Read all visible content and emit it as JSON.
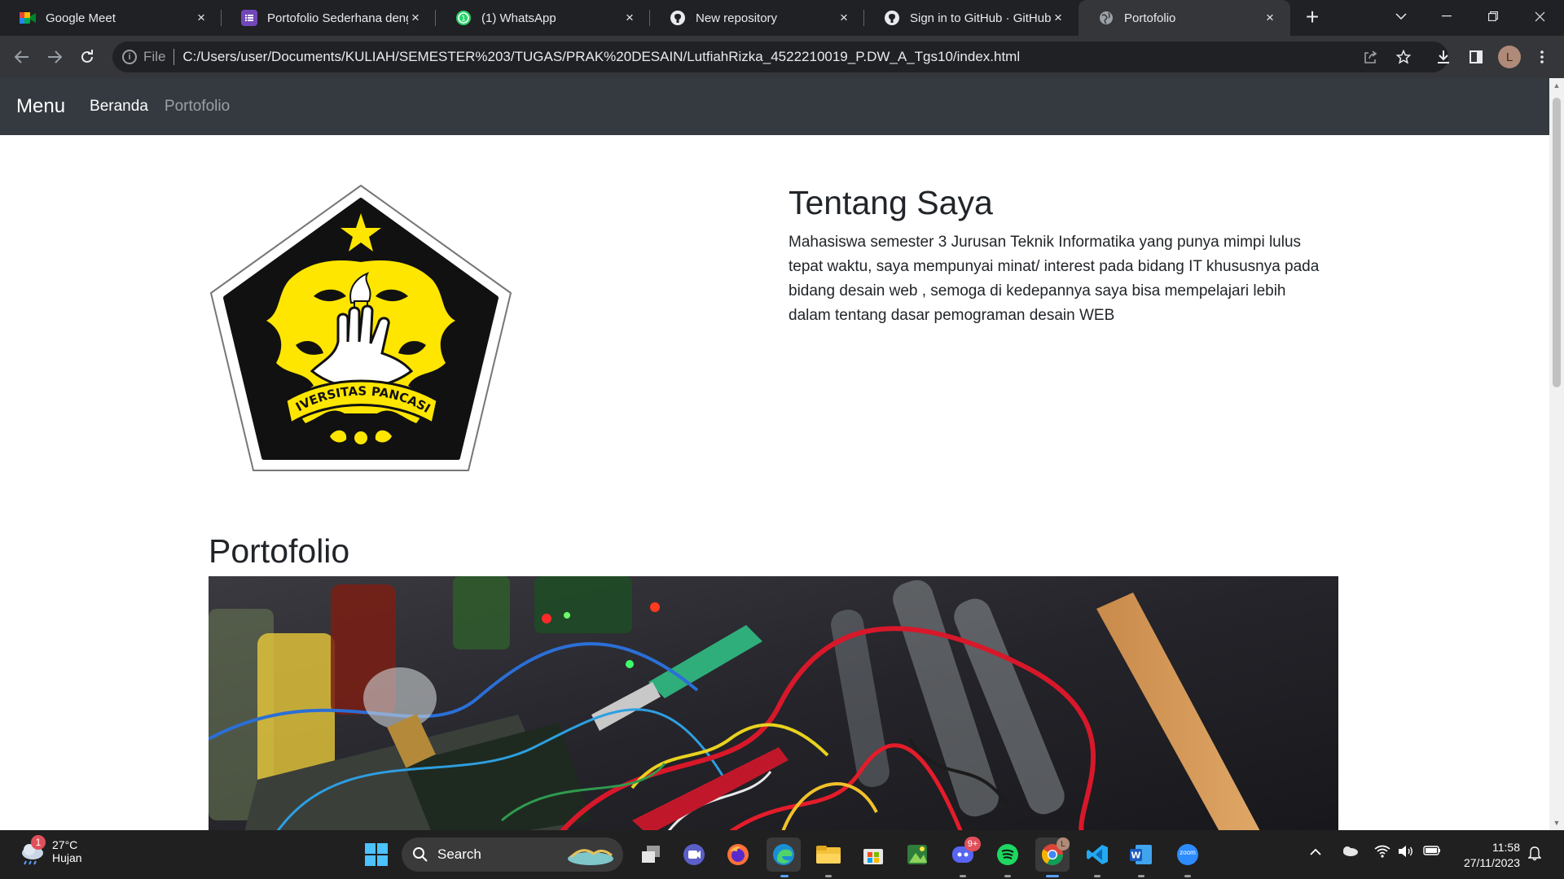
{
  "browser": {
    "tabs": [
      {
        "title": "Google Meet",
        "favicon": "google-meet-icon",
        "active": false
      },
      {
        "title": "Portofolio Sederhana deng",
        "favicon": "google-forms-icon",
        "active": false
      },
      {
        "title": "(1) WhatsApp",
        "favicon": "whatsapp-icon",
        "active": false
      },
      {
        "title": "New repository",
        "favicon": "github-icon",
        "active": false
      },
      {
        "title": "Sign in to GitHub · GitHub",
        "favicon": "github-icon",
        "active": false
      },
      {
        "title": "Portofolio",
        "favicon": "globe-icon",
        "active": true
      }
    ],
    "close_glyph": "×",
    "new_tab_glyph": "+",
    "address": {
      "scheme_label": "File",
      "url": "C:/Users/user/Documents/KULIAH/SEMESTER%203/TUGAS/PRAK%20DESAIN/LutfiahRizka_4522210019_P.DW_A_Tgs10/index.html"
    },
    "profile_initial": "L"
  },
  "page": {
    "navbar": {
      "brand": "Menu",
      "links": [
        {
          "label": "Beranda",
          "active": true
        },
        {
          "label": "Portofolio",
          "active": false
        }
      ]
    },
    "logo_text": "UNIVERSITAS PANCASILA",
    "about": {
      "title": "Tentang Saya",
      "body": "Mahasiswa semester 3 Jurusan Teknik Informatika yang punya mimpi lulus tepat waktu, saya mempunyai minat/ interest pada bidang IT khususnya pada bidang desain web , semoga di kedepannya saya bisa mempelajari lebih dalam tentang dasar pemograman desain WEB"
    },
    "portfolio_title": "Portofolio"
  },
  "taskbar": {
    "weather": {
      "temp": "27°C",
      "condition": "Hujan",
      "badge": "1"
    },
    "search_label": "Search",
    "discord_badge": "9+",
    "chrome_profile": "L",
    "zoom_label": "zoom",
    "time": "11:58",
    "date": "27/11/2023"
  },
  "colors": {
    "navbar_bg": "#343a40",
    "chrome_dark": "#202124",
    "chrome_toolbar": "#35363a",
    "logo_yellow": "#ffe600"
  }
}
